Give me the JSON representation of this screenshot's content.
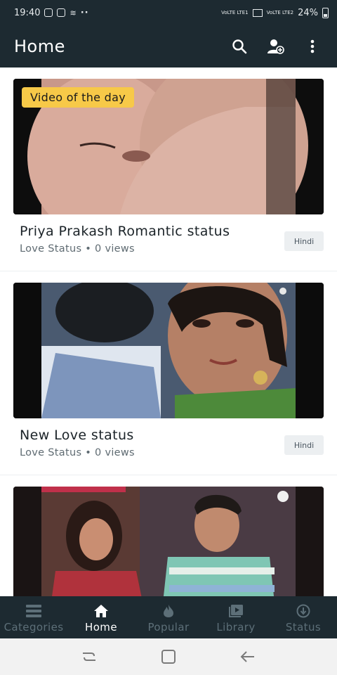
{
  "status_bar": {
    "time": "19:40",
    "left_icons": [
      "instagram-icon",
      "instagram-icon",
      "notification-icon"
    ],
    "more": "··",
    "network_1": "VoLTE LTE1",
    "network_2": "VoLTE LTE2",
    "battery": "24%"
  },
  "app_bar": {
    "title": "Home",
    "icons": [
      "search-icon",
      "account-add-icon",
      "more-vert-icon"
    ]
  },
  "feed": {
    "items": [
      {
        "badge": "Video of the day",
        "title": "Priya Prakash Romantic status",
        "category": "Love Status",
        "separator": "•",
        "views": "0 views",
        "language": "Hindi"
      },
      {
        "title": "New Love status",
        "category": "Love Status",
        "separator": "•",
        "views": "0 views",
        "language": "Hindi"
      },
      {}
    ]
  },
  "bottom_nav": {
    "items": [
      {
        "label": "Categories",
        "icon": "categories-icon",
        "active": false
      },
      {
        "label": "Home",
        "icon": "home-icon",
        "active": true
      },
      {
        "label": "Popular",
        "icon": "flame-icon",
        "active": false
      },
      {
        "label": "Library",
        "icon": "library-icon",
        "active": false
      },
      {
        "label": "Status",
        "icon": "download-icon",
        "active": false
      }
    ]
  },
  "system_nav": [
    "recents-icon",
    "home-button-icon",
    "back-icon"
  ],
  "colors": {
    "bar_bg": "#1d2a31",
    "accent_badge": "#f7c948",
    "nav_inactive": "#5d6f78",
    "nav_active": "#ffffff"
  }
}
